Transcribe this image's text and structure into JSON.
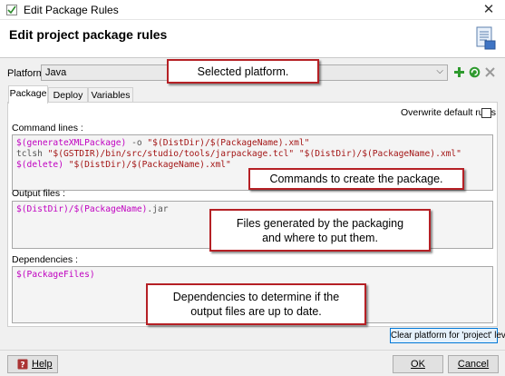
{
  "window": {
    "title": "Edit Package Rules",
    "close_glyph": "✕"
  },
  "header": {
    "title": "Edit project package rules",
    "icon": "rules-document-icon"
  },
  "platform": {
    "label": "Platform :",
    "value": "Java"
  },
  "tabs": [
    {
      "label": "Package"
    },
    {
      "label": "Deploy"
    },
    {
      "label": "Variables"
    }
  ],
  "overwrite_label": "Overwrite default rules",
  "command_lines": {
    "label": "Command lines :",
    "lines": [
      [
        {
          "t": "$(generateXMLPackage)",
          "c": "pink"
        },
        {
          "t": " -o ",
          "c": "plain"
        },
        {
          "t": "\"$(DistDir)/$(PackageName).xml\"",
          "c": "brown"
        }
      ],
      [
        {
          "t": "tclsh ",
          "c": "plain"
        },
        {
          "t": "\"$(GSTDIR)/bin/src/studio/tools/jarpackage.tcl\" \"$(DistDir)/$(PackageName).xml\"",
          "c": "brown"
        }
      ],
      [
        {
          "t": "$(delete)",
          "c": "pink"
        },
        {
          "t": " ",
          "c": "plain"
        },
        {
          "t": "\"$(DistDir)/$(PackageName).xml\"",
          "c": "brown"
        }
      ]
    ]
  },
  "output_files": {
    "label": "Output files :",
    "lines": [
      [
        {
          "t": "$(DistDir)/$(PackageName)",
          "c": "pink"
        },
        {
          "t": ".jar",
          "c": "plain"
        }
      ]
    ]
  },
  "dependencies": {
    "label": "Dependencies :",
    "lines": [
      [
        {
          "t": "$(PackageFiles)",
          "c": "pink"
        }
      ]
    ]
  },
  "callouts": {
    "platform": "Selected platform.",
    "commands": "Commands to create the package.",
    "files": "Files generated by the packaging and where to put them.",
    "deps": "Dependencies to determine if the output files are up to date."
  },
  "buttons": {
    "clear": "Clear platform for 'project' level",
    "help": "Help",
    "ok": "OK",
    "cancel": "Cancel"
  },
  "colors": {
    "pink": "#c000c0",
    "brown": "#a31515",
    "callout_border": "#b52025",
    "accent": "#0078d7"
  }
}
